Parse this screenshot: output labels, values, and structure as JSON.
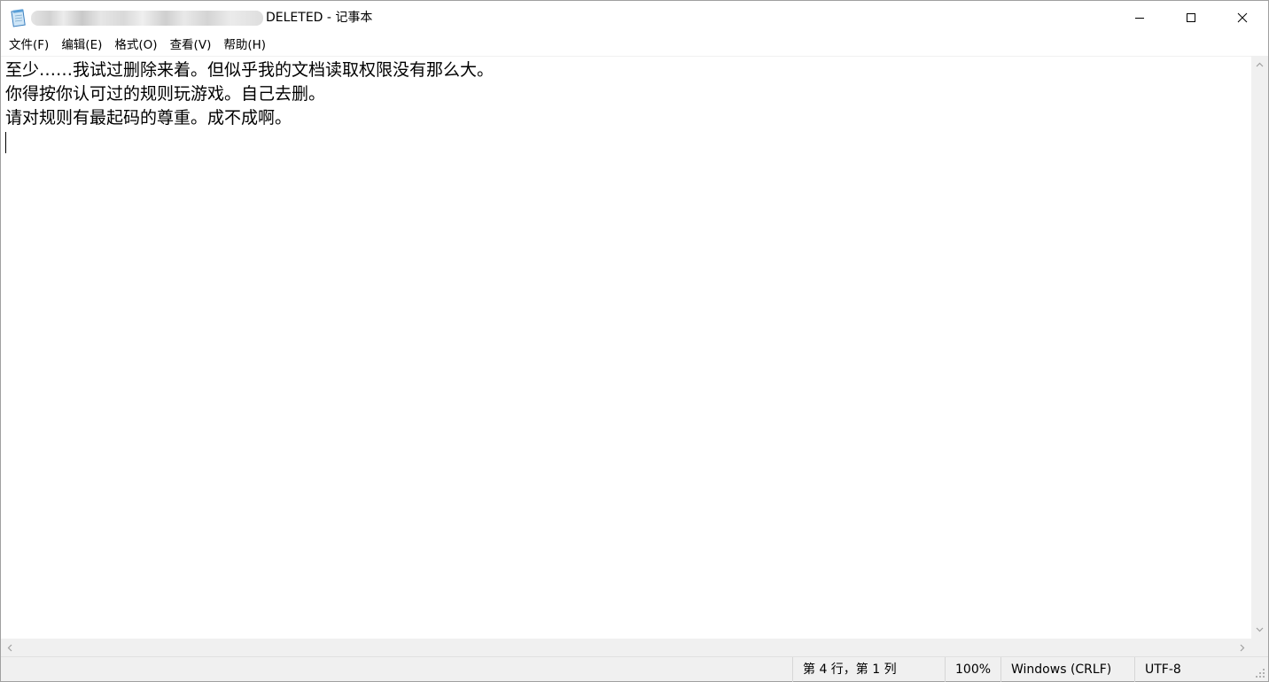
{
  "window": {
    "title": "DELETED - 记事本",
    "icons": {
      "app": "notepad-icon",
      "minimize": "minimize-icon",
      "maximize": "maximize-icon",
      "close": "close-icon"
    }
  },
  "menu": {
    "items": [
      {
        "label": "文件(F)"
      },
      {
        "label": "编辑(E)"
      },
      {
        "label": "格式(O)"
      },
      {
        "label": "查看(V)"
      },
      {
        "label": "帮助(H)"
      }
    ]
  },
  "editor": {
    "lines": [
      "至少……我试过删除来着。但似乎我的文档读取权限没有那么大。",
      "你得按你认可过的规则玩游戏。自己去删。",
      "请对规则有最起码的尊重。成不成啊。",
      ""
    ]
  },
  "status": {
    "position": "第 4 行，第 1 列",
    "zoom": "100%",
    "line_ending": "Windows (CRLF)",
    "encoding": "UTF-8"
  },
  "colors": {
    "chrome": "#f0f0f0",
    "text": "#000000"
  }
}
